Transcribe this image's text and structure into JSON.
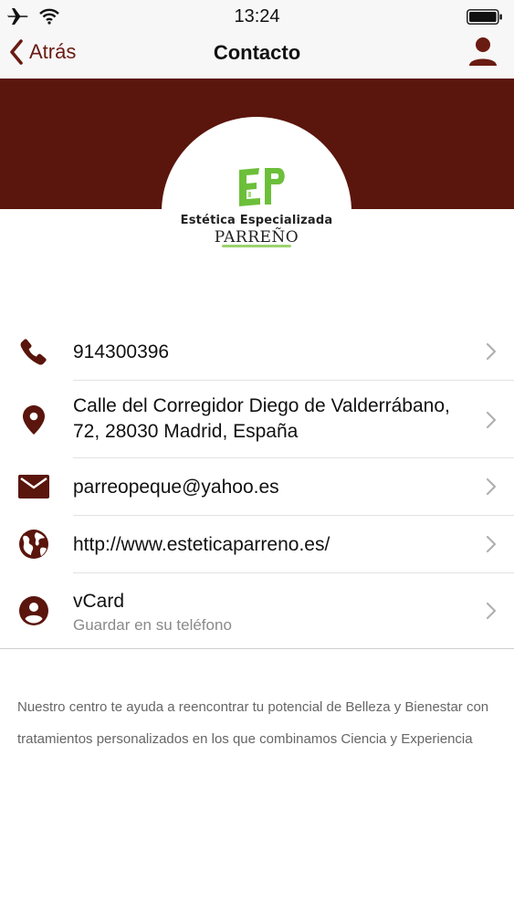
{
  "status_bar": {
    "time": "13:24"
  },
  "nav": {
    "back_label": "Atrás",
    "title": "Contacto"
  },
  "logo": {
    "line1": "Estética Especializada",
    "line2": "PARREÑO"
  },
  "contact": {
    "phone": "914300396",
    "address": "Calle del Corregidor Diego de Valderrábano, 72, 28030 Madrid, España",
    "email": "parreopeque@yahoo.es",
    "website": "http://www.esteticaparreno.es/",
    "vcard_label": "vCard",
    "vcard_sub": "Guardar en su teléfono"
  },
  "description": "Nuestro centro te ayuda a reencontrar tu potencial de Belleza y Bienestar con tratamientos personalizados en los que combinamos Ciencia y Experiencia",
  "colors": {
    "brand": "#5a150c",
    "accent": "#6a1b12",
    "logo_green": "#6cbf3a"
  },
  "icons": [
    "airplane-icon",
    "wifi-icon",
    "battery-icon",
    "chevron-left-icon",
    "user-icon",
    "phone-icon",
    "location-pin-icon",
    "envelope-icon",
    "globe-icon",
    "account-circle-icon",
    "chevron-right-icon"
  ]
}
